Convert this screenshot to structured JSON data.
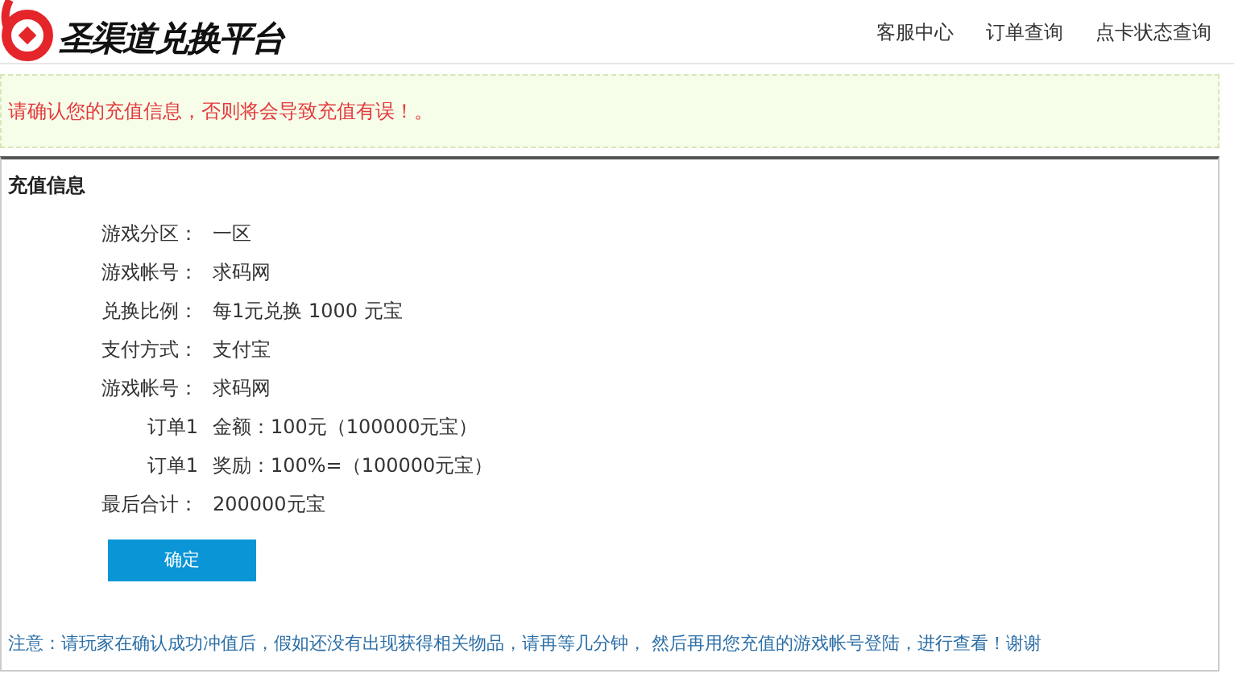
{
  "header": {
    "logo_text": "圣渠道兑换平台",
    "nav": [
      "客服中心",
      "订单查询",
      "点卡状态查询"
    ]
  },
  "notice": "请确认您的充值信息，否则将会导致充值有误！。",
  "panel": {
    "title": "充值信息",
    "rows": [
      {
        "label": "游戏分区：",
        "value": "一区"
      },
      {
        "label": "游戏帐号：",
        "value": "求码网"
      },
      {
        "label": "兑换比例：",
        "value": "每1元兑换 1000 元宝"
      },
      {
        "label": "支付方式：",
        "value": "支付宝"
      },
      {
        "label": "游戏帐号：",
        "value": "求码网"
      },
      {
        "label": "订单1",
        "value": "金额：100元（100000元宝）"
      },
      {
        "label": "订单1",
        "value": "奖励：100%=（100000元宝）"
      },
      {
        "label": "最后合计：",
        "value": "200000元宝"
      }
    ],
    "button": "确定",
    "note": "注意：请玩家在确认成功冲值后，假如还没有出现获得相关物品，请再等几分钟， 然后再用您充值的游戏帐号登陆，进行查看！谢谢"
  }
}
